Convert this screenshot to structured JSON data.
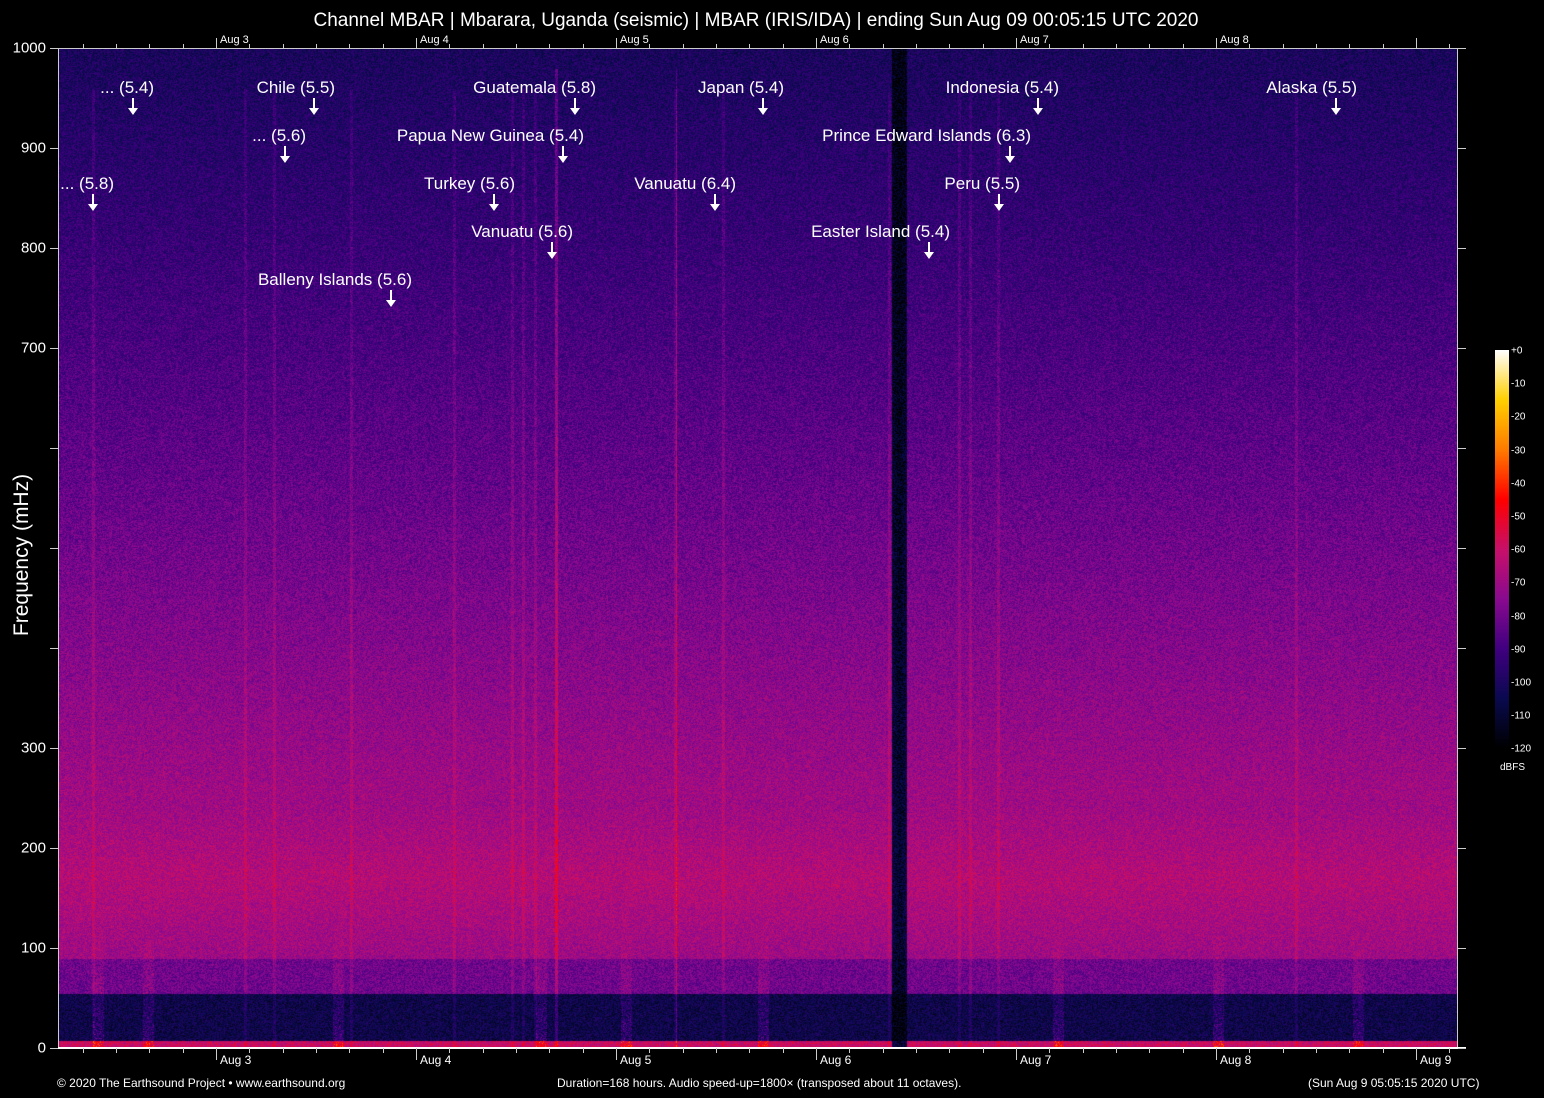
{
  "title": "Channel MBAR | Mbarara, Uganda (seismic) | MBAR (IRIS/IDA) | ending Sun Aug 09 00:05:15 UTC 2020",
  "chart_data": {
    "type": "heatmap",
    "title": "Channel MBAR | Mbarara, Uganda (seismic) | MBAR (IRIS/IDA) | ending Sun Aug 09 00:05:15 UTC 2020",
    "xlabel": "",
    "ylabel": "Frequency (mHz)",
    "x_unit": "hours",
    "xlim": [
      0,
      168
    ],
    "ylim": [
      0,
      1000
    ],
    "y_ticks": [
      0,
      100,
      200,
      300,
      400,
      500,
      600,
      700,
      800,
      900,
      1000
    ],
    "y_tick_labels": [
      "0",
      "100",
      "200",
      "300",
      "",
      "",
      "",
      "700",
      "800",
      "900",
      "1000"
    ],
    "x_date_ticks": [
      {
        "label": "Aug 3",
        "hour": 18.96
      },
      {
        "label": "Aug 4",
        "hour": 42.96
      },
      {
        "label": "Aug 5",
        "hour": 66.96
      },
      {
        "label": "Aug 6",
        "hour": 90.96
      },
      {
        "label": "Aug 7",
        "hour": 114.96
      },
      {
        "label": "Aug 8",
        "hour": 138.96
      },
      {
        "label": "Aug 9",
        "hour": 162.96
      }
    ],
    "top_axis_labels": [
      "Aug 3",
      "Aug 4",
      "Aug 5",
      "Aug 6",
      "Aug 7",
      "Aug 8"
    ],
    "colorbar": {
      "unit": "dBFS",
      "range": [
        -120,
        0
      ],
      "tick_labels": [
        "+0",
        "-10",
        "-20",
        "-30",
        "-40",
        "-50",
        "-60",
        "-70",
        "-80",
        "-90",
        "-100",
        "-110",
        "-120"
      ],
      "colors": [
        "#000000",
        "#0a0a50",
        "#400080",
        "#8a0a90",
        "#c8106a",
        "#ff0000",
        "#ff7a00",
        "#ffd000",
        "#ffffff"
      ]
    },
    "events": [
      {
        "label": "... (5.4)",
        "hour": 9.0,
        "row": 1
      },
      {
        "label": "Chile (5.5)",
        "hour": 30.72,
        "row": 1
      },
      {
        "label": "Guatemala (5.8)",
        "hour": 62.04,
        "row": 1
      },
      {
        "label": "Japan (5.4)",
        "hour": 84.6,
        "row": 1
      },
      {
        "label": "Indonesia (5.4)",
        "hour": 117.6,
        "row": 1
      },
      {
        "label": "Alaska (5.5)",
        "hour": 153.36,
        "row": 1
      },
      {
        "label": "... (5.6)",
        "hour": 27.24,
        "row": 2
      },
      {
        "label": "Papua New Guinea (5.4)",
        "hour": 60.6,
        "row": 2
      },
      {
        "label": "Prince Edward Islands (6.3)",
        "hour": 114.24,
        "row": 2
      },
      {
        "label": "... (5.8)",
        "hour": 4.2,
        "row": 3
      },
      {
        "label": "Turkey (5.6)",
        "hour": 52.32,
        "row": 3
      },
      {
        "label": "Vanuatu (6.4)",
        "hour": 78.84,
        "row": 3
      },
      {
        "label": "Peru (5.5)",
        "hour": 112.92,
        "row": 3
      },
      {
        "label": "Vanuatu (5.6)",
        "hour": 59.28,
        "row": 4
      },
      {
        "label": "Easter Island (5.4)",
        "hour": 104.52,
        "row": 4
      },
      {
        "label": "Balleny Islands (5.6)",
        "hour": 39.96,
        "row": 5
      }
    ]
  },
  "footer": {
    "copyright": "© 2020 The Earthsound Project • www.earthsound.org",
    "info": "Duration=168 hours. Audio speed-up=1800× (transposed about 11 octaves).",
    "end_time": "(Sun Aug  9 05:05:15 2020 UTC)"
  }
}
